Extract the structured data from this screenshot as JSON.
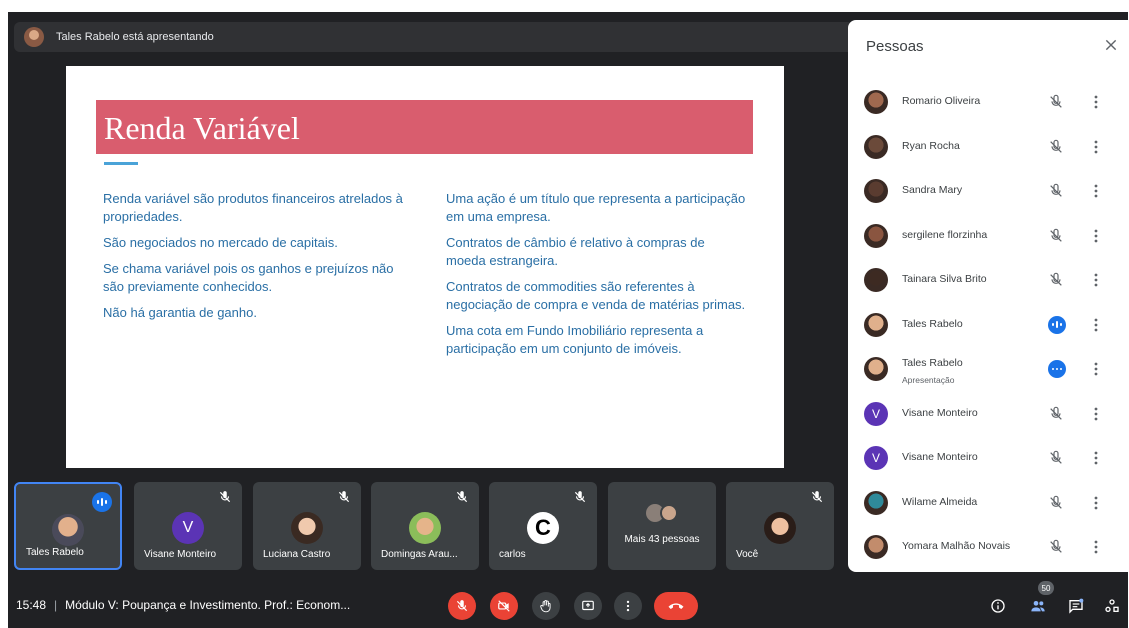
{
  "banner": {
    "text": "Tales Rabelo está apresentando"
  },
  "slide": {
    "title": "Renda Variável",
    "left": [
      "Renda variável são produtos financeiros atrelados à propriedades.",
      "São negociados no mercado de capitais.",
      "Se chama variável pois os ganhos e prejuízos não são previamente conhecidos.",
      "Não há garantia de ganho."
    ],
    "right": [
      "Uma ação é um título que representa a participação em uma empresa.",
      "Contratos de câmbio é relativo à compras de moeda estrangeira.",
      "Contratos de commodities são referentes à negociação de compra e venda de matérias primas.",
      "Uma cota em Fundo Imobiliário representa a participação em um conjunto de imóveis."
    ]
  },
  "tiles": [
    {
      "name": "Tales Rabelo",
      "state": "speaking"
    },
    {
      "name": "Visane Monteiro",
      "letter": "V",
      "state": "muted"
    },
    {
      "name": "Luciana Castro",
      "state": "muted"
    },
    {
      "name": "Domingas Arau...",
      "state": "muted"
    },
    {
      "name": "carlos",
      "letter": "C",
      "state": "muted"
    },
    {
      "name": "Mais 43 pessoas"
    },
    {
      "name": "Você",
      "state": "muted"
    }
  ],
  "bottombar": {
    "time": "15:48",
    "separator": "|",
    "meeting_title": "Módulo V: Poupança e Investimento. Prof.: Econom...",
    "participants_count": "50",
    "icons": [
      "mic-off-icon",
      "camera-off-icon",
      "raise-hand-icon",
      "present-icon",
      "more-options-icon",
      "end-call-icon",
      "info-icon",
      "people-icon",
      "chat-icon",
      "activities-icon"
    ]
  },
  "panel": {
    "title": "Pessoas",
    "people": [
      {
        "name": "Romario Oliveira",
        "state": "muted"
      },
      {
        "name": "Ryan Rocha",
        "state": "muted"
      },
      {
        "name": "Sandra Mary",
        "state": "muted"
      },
      {
        "name": "sergilene florzinha",
        "state": "muted"
      },
      {
        "name": "Tainara Silva Brito",
        "state": "muted"
      },
      {
        "name": "Tales Rabelo",
        "state": "speaking"
      },
      {
        "name": "Tales Rabelo",
        "sub": "Apresentação",
        "state": "presenting"
      },
      {
        "name": "Visane Monteiro",
        "letter": "V",
        "state": "muted"
      },
      {
        "name": "Visane Monteiro",
        "letter": "V",
        "state": "muted"
      },
      {
        "name": "Wilame Almeida",
        "state": "muted"
      },
      {
        "name": "Yomara Malhão Novais",
        "state": "muted"
      }
    ]
  },
  "colors": {
    "bg": "#202124",
    "tile": "#3c4043",
    "accent": "#1a73e8",
    "danger": "#ea4335",
    "slide_band": "#d95d6e",
    "slide_text": "#2a6fa5"
  }
}
